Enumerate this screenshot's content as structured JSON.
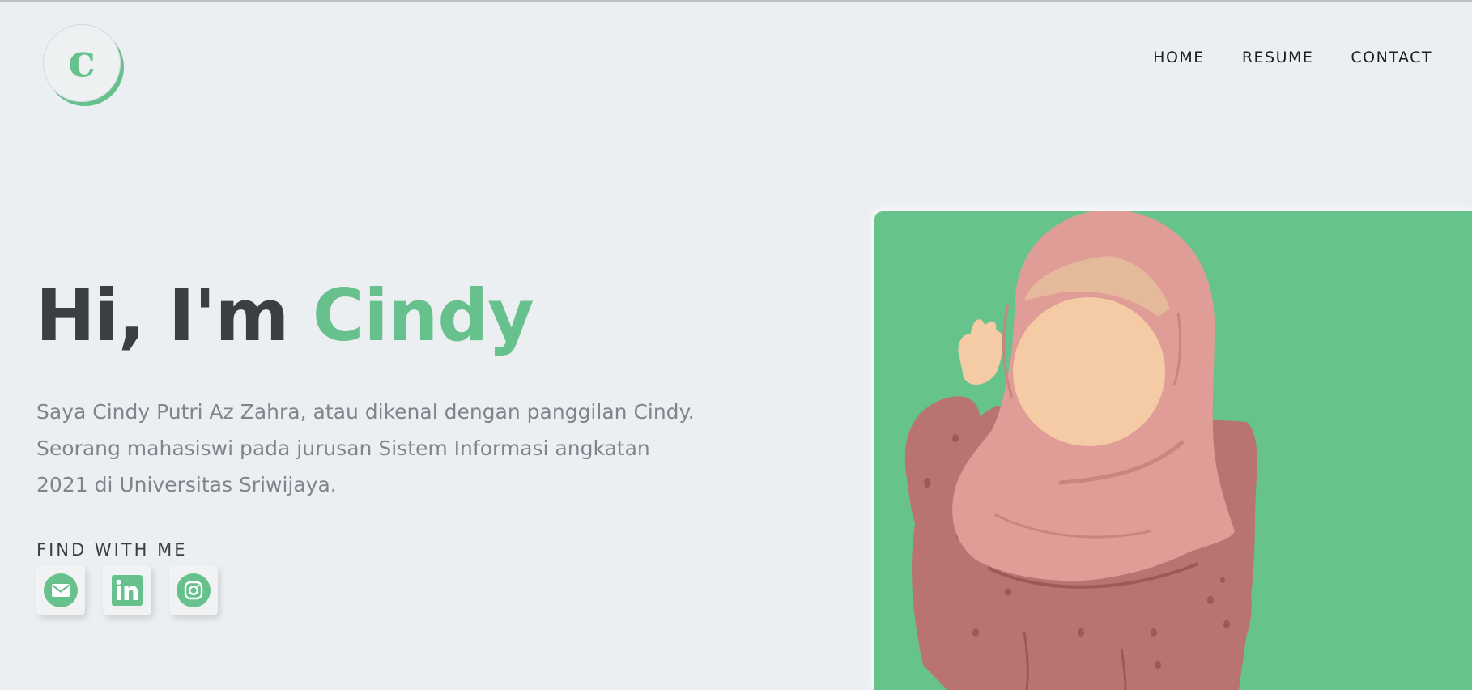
{
  "brand": {
    "logo_letter": "c",
    "accent_color": "#66c18c"
  },
  "nav": {
    "items": [
      {
        "label": "HOME"
      },
      {
        "label": "RESUME"
      },
      {
        "label": "CONTACT"
      }
    ]
  },
  "hero": {
    "greeting": "Hi, I'm",
    "name": "Cindy",
    "description": "Saya Cindy Putri Az Zahra, atau dikenal dengan panggilan Cindy. Seorang mahasiswi pada jurusan Sistem Informasi angkatan 2021 di Universitas Sriwijaya.",
    "find_label": "FIND WITH ME",
    "socials": [
      {
        "icon": "email-icon"
      },
      {
        "icon": "linkedin-icon"
      },
      {
        "icon": "instagram-icon"
      }
    ],
    "illustration": {
      "icon": "hijab-girl-waving-illustration",
      "background_color": "#66c38b"
    }
  }
}
